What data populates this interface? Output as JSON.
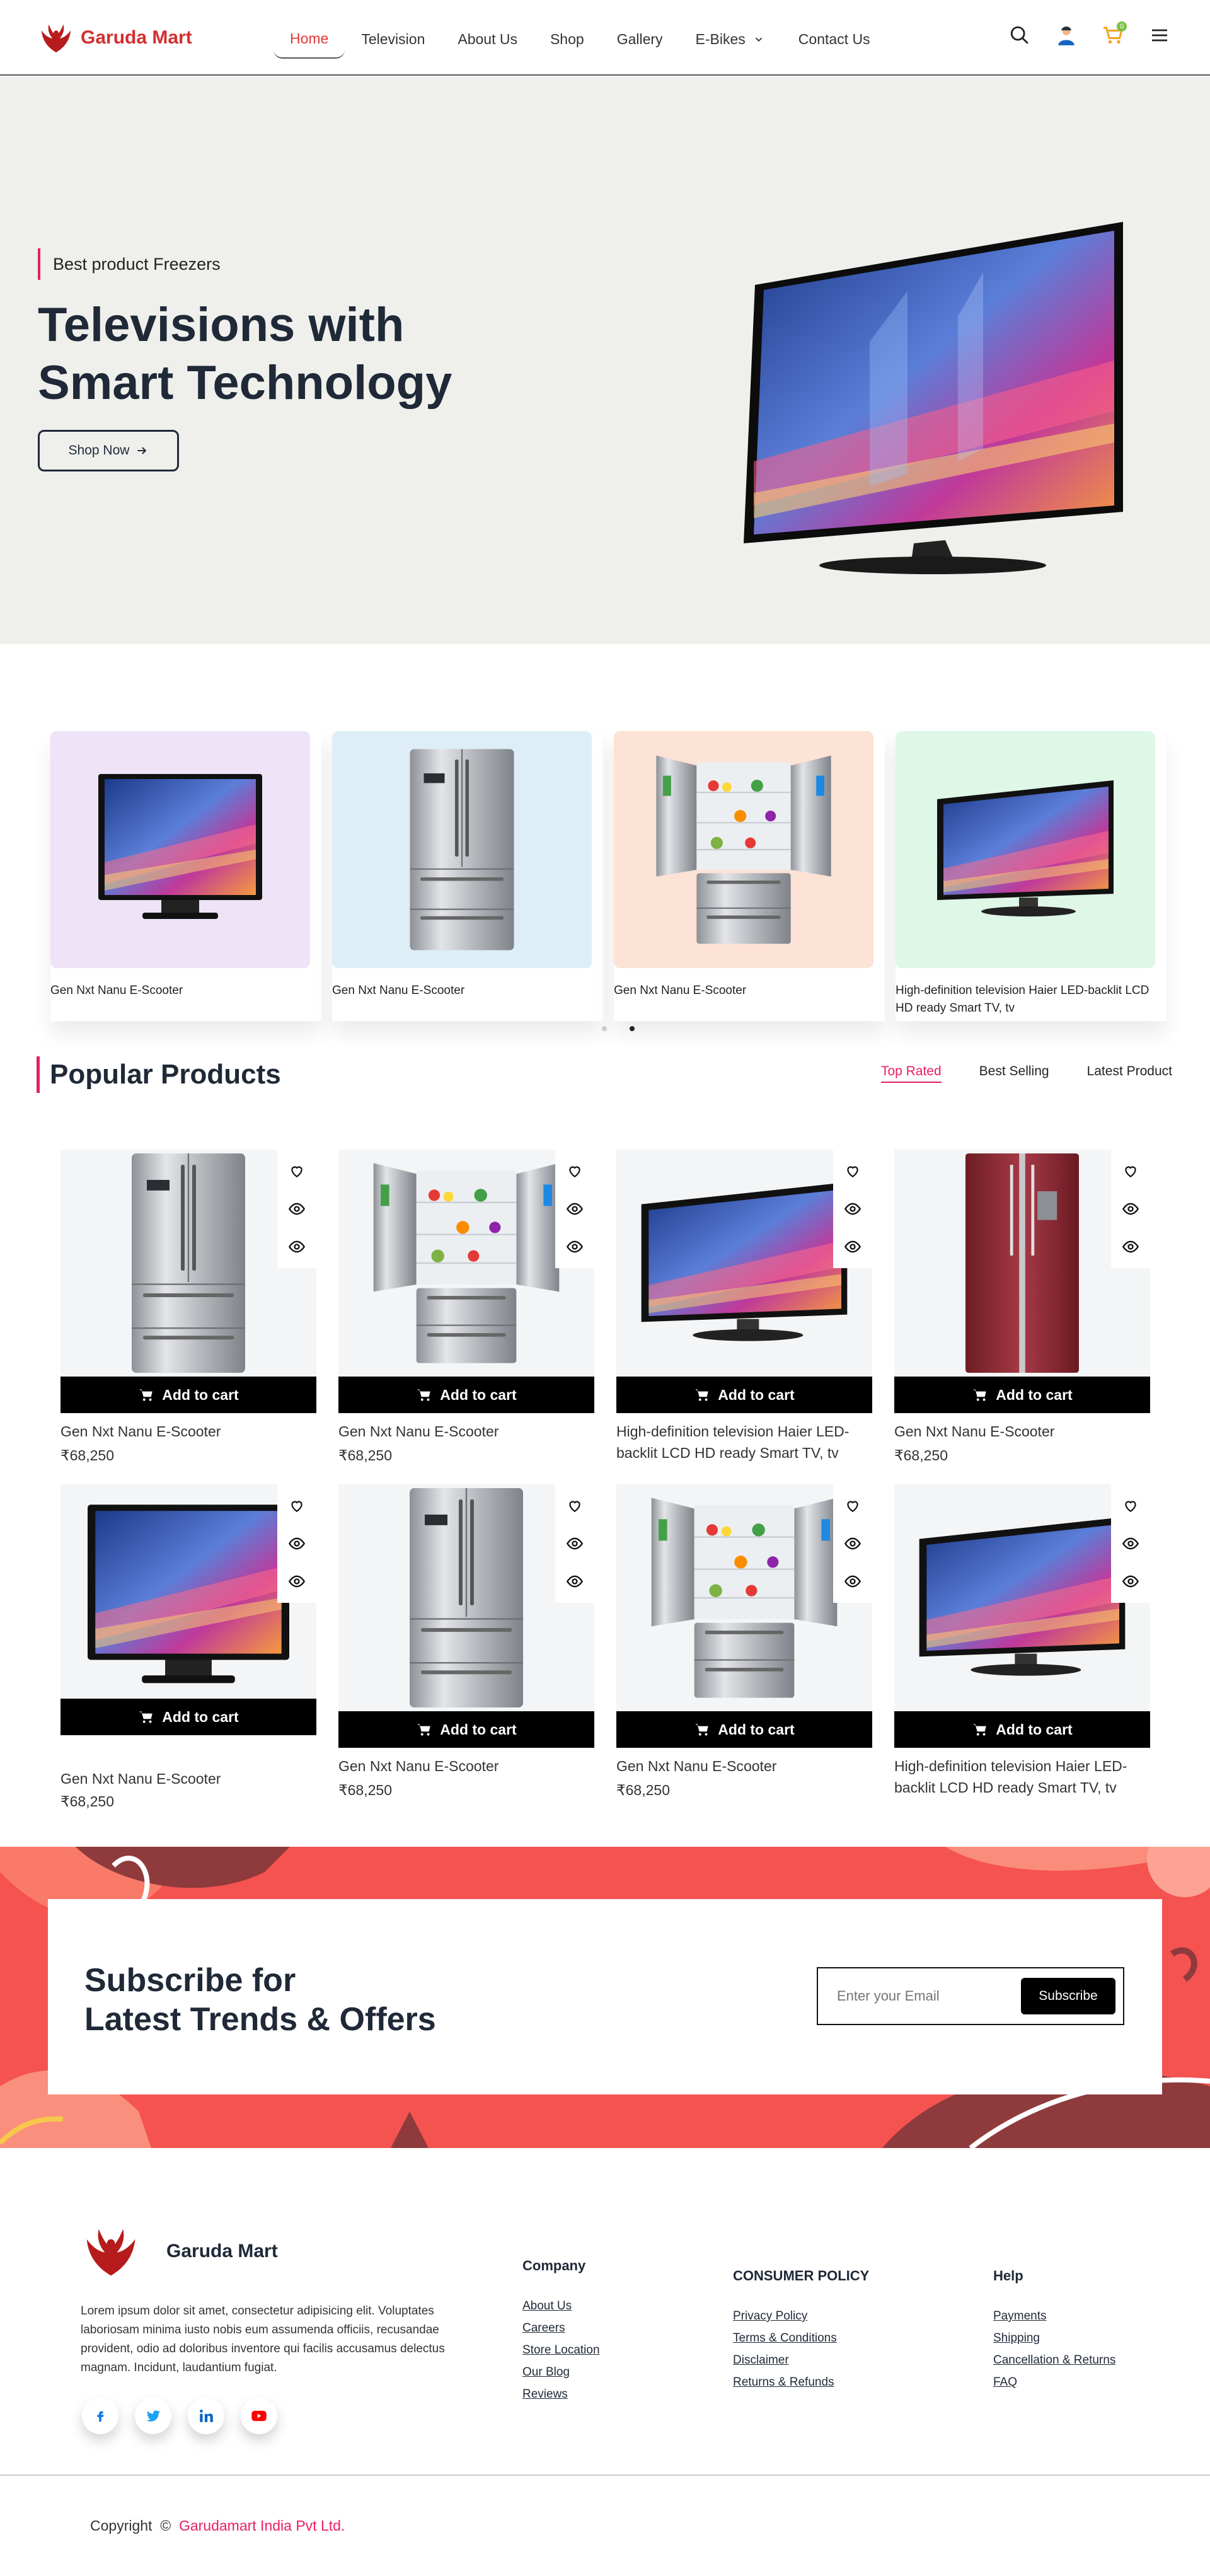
{
  "header": {
    "brand": "Garuda Mart",
    "nav": [
      {
        "label": "Home",
        "active": true
      },
      {
        "label": "Television"
      },
      {
        "label": "About Us"
      },
      {
        "label": "Shop"
      },
      {
        "label": "Gallery"
      },
      {
        "label": "E-Bikes",
        "has_dropdown": true
      },
      {
        "label": "Contact Us"
      }
    ],
    "icons": [
      "search-icon",
      "user-icon",
      "cart-icon",
      "menu-icon"
    ],
    "cart_count": "0"
  },
  "hero": {
    "eyebrow": "Best product Freezers",
    "title_line1": "Televisions with",
    "title_line2": "Smart Technology",
    "cta": "Shop Now"
  },
  "carousel": {
    "items": [
      {
        "title": "Gen Nxt Nanu E-Scooter",
        "bg": "#efe3f7",
        "kind": "tv-front"
      },
      {
        "title": "Gen Nxt Nanu E-Scooter",
        "bg": "#ddeef7",
        "kind": "fridge-closed"
      },
      {
        "title": "Gen Nxt Nanu E-Scooter",
        "bg": "#fde2d6",
        "kind": "fridge-open"
      },
      {
        "title": "High-definition television Haier LED-backlit LCD HD ready Smart TV, tv",
        "bg": "#dff7e6",
        "kind": "tv-angle"
      }
    ],
    "dots": 2,
    "active_dot": 1
  },
  "popular": {
    "title": "Popular Products",
    "tabs": [
      {
        "label": "Top Rated",
        "active": true
      },
      {
        "label": "Best Selling"
      },
      {
        "label": "Latest Product"
      }
    ],
    "add_to_cart": "Add to cart",
    "products": [
      {
        "name": "Gen Nxt Nanu E-Scooter",
        "price": "₹68,250",
        "kind": "fridge-closed"
      },
      {
        "name": "Gen Nxt Nanu E-Scooter",
        "price": "₹68,250",
        "kind": "fridge-open"
      },
      {
        "name": "High-definition television Haier LED-backlit LCD HD ready Smart TV, tv",
        "price": "",
        "kind": "tv-angle"
      },
      {
        "name": "Gen Nxt Nanu E-Scooter",
        "price": "₹68,250",
        "kind": "fridge-red"
      },
      {
        "name": "Gen Nxt Nanu E-Scooter",
        "price": "₹68,250",
        "kind": "tv-front"
      },
      {
        "name": "Gen Nxt Nanu E-Scooter",
        "price": "₹68,250",
        "kind": "fridge-closed"
      },
      {
        "name": "Gen Nxt Nanu E-Scooter",
        "price": "₹68,250",
        "kind": "fridge-open"
      },
      {
        "name": "High-definition television Haier LED-backlit LCD HD ready Smart TV, tv",
        "price": "",
        "kind": "tv-angle"
      }
    ]
  },
  "subscribe": {
    "title_line1": "Subscribe for",
    "title_line2": "Latest Trends & Offers",
    "placeholder": "Enter your Email",
    "button": "Subscribe"
  },
  "footer": {
    "brand": "Garuda Mart",
    "about": "Lorem ipsum dolor sit amet, consectetur adipisicing elit. Voluptates laboriosam minima iusto nobis eum assumenda officiis, recusandae provident, odio ad doloribus inventore qui facilis accusamus delectus magnam. Incidunt, laudantium fugiat.",
    "socials": [
      "facebook-icon",
      "twitter-icon",
      "linkedin-icon",
      "youtube-icon"
    ],
    "company": {
      "heading": "Company",
      "links": [
        "About Us",
        "Careers",
        "Store Location",
        "Our Blog",
        "Reviews"
      ]
    },
    "policy": {
      "heading": "CONSUMER POLICY",
      "links": [
        "Privacy Policy",
        "Terms & Conditions",
        "Disclaimer",
        "Returns & Refunds"
      ]
    },
    "help": {
      "heading": "Help",
      "links": [
        "Payments",
        "Shipping",
        "Cancellation & Returns",
        "FAQ"
      ]
    },
    "copyright_prefix": "Copyright  ©  ",
    "company_name": "Garudamart India Pvt Ltd."
  }
}
